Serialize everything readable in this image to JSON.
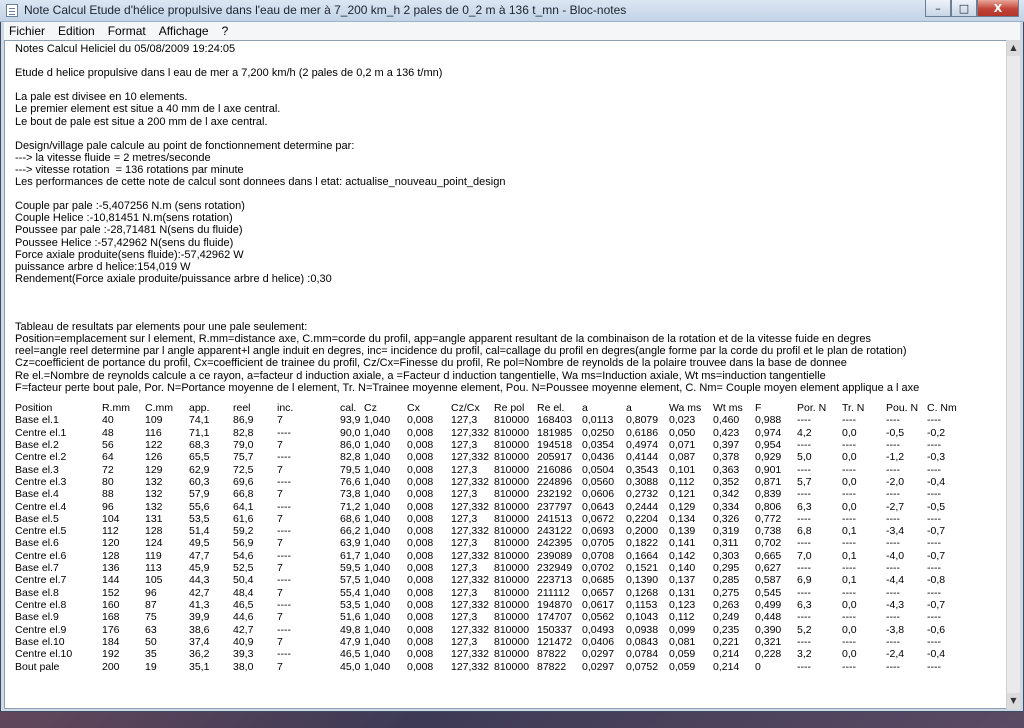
{
  "window": {
    "title": "Note Calcul Etude d'hélice propulsive dans l'eau de mer à 7_200 km_h 2 pales de 0_2 m à 136 t_mn - Bloc-notes",
    "buttons": [
      "–",
      "□",
      "X"
    ]
  },
  "menu": [
    "Fichier",
    "Edition",
    "Format",
    "Affichage",
    "?"
  ],
  "text_lines": [
    "Notes Calcul Heliciel du 05/08/2009 19:24:05",
    "",
    "Etude d helice propulsive dans l eau de mer a 7,200 km/h (2 pales de 0,2 m a 136 t/mn)",
    "",
    "La pale est divisee en 10 elements.",
    "Le premier element est situe a 40 mm de l axe central.",
    "Le bout de pale est situe a 200 mm de l axe central.",
    "",
    "Design/village pale calcule au point de fonctionnement determine par:",
    "---> la vitesse fluide = 2 metres/seconde",
    "---> vitesse rotation  = 136 rotations par minute",
    "Les performances de cette note de calcul sont donnees dans l etat: actualise_nouveau_point_design",
    "",
    "Couple par pale :-5,407256 N.m (sens rotation)",
    "Couple Helice :-10,81451 N.m(sens rotation)",
    "Poussee par pale :-28,71481 N(sens du fluide)",
    "Poussee Helice :-57,42962 N(sens du fluide)",
    "Force axiale produite(sens fluide):-57,42962 W",
    "puissance arbre d helice:154,019 W",
    "Rendement(Force axiale produite/puissance arbre d helice) :0,30",
    "",
    "",
    "",
    "Tableau de resultats par elements pour une pale seulement:",
    "Position=emplacement sur l element, R.mm=distance axe, C.mm=corde du profil, app=angle apparent resultant de la combinaison de la rotation et de la vitesse fuide en degres",
    "reel=angle reel determine par l angle apparent+l angle induit en degres, inc= incidence du profil, cal=callage du profil en degres(angle forme par la corde du profil et le plan de rotation)",
    "Cz=coefficient de portance du profil, Cx=coefficient de trainee du profil, Cz/Cx=Finesse du profil, Re pol=Nombre de reynolds de la polaire trouvee dans la base de donnee",
    "Re el.=Nombre de reynolds calcule a ce rayon, a=facteur d induction axiale, a =Facteur d induction tangentielle, Wa ms=Induction axiale, Wt ms=induction tangentielle",
    "F=facteur perte bout pale, Por. N=Portance moyenne de l element, Tr. N=Trainee moyenne element, Pou. N=Poussee moyenne element, C. Nm= Couple moyen element applique a l axe"
  ],
  "table": {
    "headers": [
      "Position",
      "R.mm",
      "C.mm",
      "app.",
      "reel",
      "inc.",
      "cal.",
      "Cz",
      "Cx",
      "Cz/Cx",
      "Re pol",
      "Re el.",
      "a",
      "a",
      "Wa ms",
      "Wt ms",
      "F",
      "Por. N",
      "Tr. N",
      "Pou. N",
      "C. Nm"
    ],
    "rows": [
      [
        "Base   el.1",
        "40",
        "109",
        "74,1",
        "86,9",
        "7",
        "93,9",
        "1,040",
        "0,008",
        "127,3",
        "810000",
        "168403",
        "0,0113",
        "0,8079",
        "0,023",
        "0,460",
        "0,988",
        "----",
        "----",
        "----",
        "----"
      ],
      [
        "Centre el.1",
        "48",
        "116",
        "71,1",
        "82,8",
        "----",
        "90,0",
        "1,040",
        "0,008",
        "127,332",
        "810000",
        "181985",
        "0,0250",
        "0,6186",
        "0,050",
        "0,423",
        "0,974",
        "4,2",
        "0,0",
        "-0,5",
        "-0,2"
      ],
      [
        "Base   el.2",
        "56",
        "122",
        "68,3",
        "79,0",
        "7",
        "86,0",
        "1,040",
        "0,008",
        "127,3",
        "810000",
        "194518",
        "0,0354",
        "0,4974",
        "0,071",
        "0,397",
        "0,954",
        "----",
        "----",
        "----",
        "----"
      ],
      [
        "Centre el.2",
        "64",
        "126",
        "65,5",
        "75,7",
        "----",
        "82,8",
        "1,040",
        "0,008",
        "127,332",
        "810000",
        "205917",
        "0,0436",
        "0,4144",
        "0,087",
        "0,378",
        "0,929",
        "5,0",
        "0,0",
        "-1,2",
        "-0,3"
      ],
      [
        "Base   el.3",
        "72",
        "129",
        "62,9",
        "72,5",
        "7",
        "79,5",
        "1,040",
        "0,008",
        "127,3",
        "810000",
        "216086",
        "0,0504",
        "0,3543",
        "0,101",
        "0,363",
        "0,901",
        "----",
        "----",
        "----",
        "----"
      ],
      [
        "Centre el.3",
        "80",
        "132",
        "60,3",
        "69,6",
        "----",
        "76,6",
        "1,040",
        "0,008",
        "127,332",
        "810000",
        "224896",
        "0,0560",
        "0,3088",
        "0,112",
        "0,352",
        "0,871",
        "5,7",
        "0,0",
        "-2,0",
        "-0,4"
      ],
      [
        "Base   el.4",
        "88",
        "132",
        "57,9",
        "66,8",
        "7",
        "73,8",
        "1,040",
        "0,008",
        "127,3",
        "810000",
        "232192",
        "0,0606",
        "0,2732",
        "0,121",
        "0,342",
        "0,839",
        "----",
        "----",
        "----",
        "----"
      ],
      [
        "Centre el.4",
        "96",
        "132",
        "55,6",
        "64,1",
        "----",
        "71,2",
        "1,040",
        "0,008",
        "127,332",
        "810000",
        "237797",
        "0,0643",
        "0,2444",
        "0,129",
        "0,334",
        "0,806",
        "6,3",
        "0,0",
        "-2,7",
        "-0,5"
      ],
      [
        "Base   el.5",
        "104",
        "131",
        "53,5",
        "61,6",
        "7",
        "68,6",
        "1,040",
        "0,008",
        "127,3",
        "810000",
        "241513",
        "0,0672",
        "0,2204",
        "0,134",
        "0,326",
        "0,772",
        "----",
        "----",
        "----",
        "----"
      ],
      [
        "Centre el.5",
        "112",
        "128",
        "51,4",
        "59,2",
        "----",
        "66,2",
        "1,040",
        "0,008",
        "127,332",
        "810000",
        "243122",
        "0,0693",
        "0,2000",
        "0,139",
        "0,319",
        "0,738",
        "6,8",
        "0,1",
        "-3,4",
        "-0,7"
      ],
      [
        "Base   el.6",
        "120",
        "124",
        "49,5",
        "56,9",
        "7",
        "63,9",
        "1,040",
        "0,008",
        "127,3",
        "810000",
        "242395",
        "0,0705",
        "0,1822",
        "0,141",
        "0,311",
        "0,702",
        "----",
        "----",
        "----",
        "----"
      ],
      [
        "Centre el.6",
        "128",
        "119",
        "47,7",
        "54,6",
        "----",
        "61,7",
        "1,040",
        "0,008",
        "127,332",
        "810000",
        "239089",
        "0,0708",
        "0,1664",
        "0,142",
        "0,303",
        "0,665",
        "7,0",
        "0,1",
        "-4,0",
        "-0,7"
      ],
      [
        "Base   el.7",
        "136",
        "113",
        "45,9",
        "52,5",
        "7",
        "59,5",
        "1,040",
        "0,008",
        "127,3",
        "810000",
        "232949",
        "0,0702",
        "0,1521",
        "0,140",
        "0,295",
        "0,627",
        "----",
        "----",
        "----",
        "----"
      ],
      [
        "Centre el.7",
        "144",
        "105",
        "44,3",
        "50,4",
        "----",
        "57,5",
        "1,040",
        "0,008",
        "127,332",
        "810000",
        "223713",
        "0,0685",
        "0,1390",
        "0,137",
        "0,285",
        "0,587",
        "6,9",
        "0,1",
        "-4,4",
        "-0,8"
      ],
      [
        "Base   el.8",
        "152",
        "96",
        "42,7",
        "48,4",
        "7",
        "55,4",
        "1,040",
        "0,008",
        "127,3",
        "810000",
        "211112",
        "0,0657",
        "0,1268",
        "0,131",
        "0,275",
        "0,545",
        "----",
        "----",
        "----",
        "----"
      ],
      [
        "Centre el.8",
        "160",
        "87",
        "41,3",
        "46,5",
        "----",
        "53,5",
        "1,040",
        "0,008",
        "127,332",
        "810000",
        "194870",
        "0,0617",
        "0,1153",
        "0,123",
        "0,263",
        "0,499",
        "6,3",
        "0,0",
        "-4,3",
        "-0,7"
      ],
      [
        "Base   el.9",
        "168",
        "75",
        "39,9",
        "44,6",
        "7",
        "51,6",
        "1,040",
        "0,008",
        "127,3",
        "810000",
        "174707",
        "0,0562",
        "0,1043",
        "0,112",
        "0,249",
        "0,448",
        "----",
        "----",
        "----",
        "----"
      ],
      [
        "Centre el.9",
        "176",
        "63",
        "38,6",
        "42,7",
        "----",
        "49,8",
        "1,040",
        "0,008",
        "127,332",
        "810000",
        "150337",
        "0,0493",
        "0,0938",
        "0,099",
        "0,235",
        "0,390",
        "5,2",
        "0,0",
        "-3,8",
        "-0,6"
      ],
      [
        "Base   el.10",
        "184",
        "50",
        "37,4",
        "40,9",
        "7",
        "47,9",
        "1,040",
        "0,008",
        "127,3",
        "810000",
        "121472",
        "0,0406",
        "0,0843",
        "0,081",
        "0,221",
        "0,321",
        "----",
        "----",
        "----",
        "----"
      ],
      [
        "Centre el.10",
        "192",
        "35",
        "36,2",
        "39,3",
        "----",
        "46,5",
        "1,040",
        "0,008",
        "127,332",
        "810000",
        "87822",
        "0,0297",
        "0,0784",
        "0,059",
        "0,214",
        "0,228",
        "3,2",
        "0,0",
        "-2,4",
        "-0,4"
      ],
      [
        "Bout pale",
        "200",
        "19",
        "35,1",
        "38,0",
        "7",
        "45,0",
        "1,040",
        "0,008",
        "127,332",
        "810000",
        "87822",
        "0,0297",
        "0,0752",
        "0,059",
        "0,214",
        "0",
        "----",
        "----",
        "----",
        "----"
      ]
    ]
  }
}
